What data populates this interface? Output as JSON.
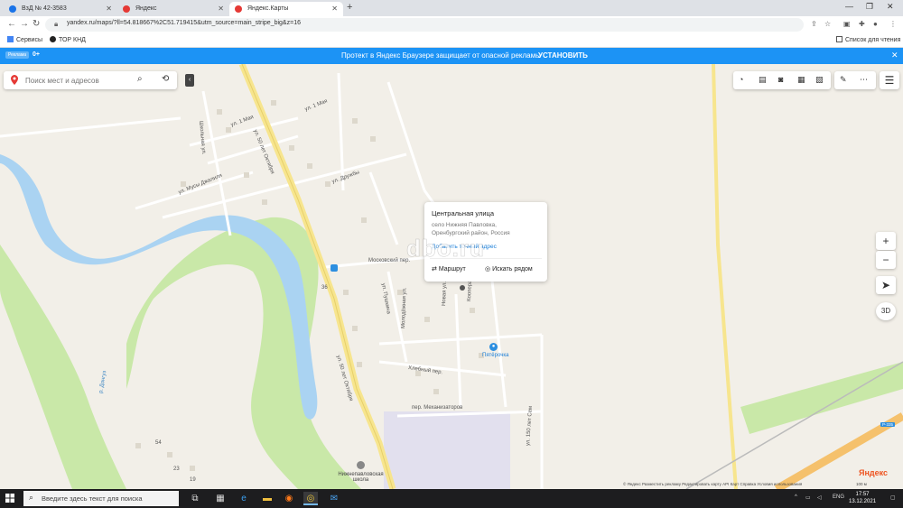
{
  "browser": {
    "tabs": [
      {
        "label": "ВзД № 42-3583",
        "color": "#1a73e8"
      },
      {
        "label": "Яндекс",
        "color": "#e53935"
      },
      {
        "label": "Яндекс.Карты",
        "color": "#e53935",
        "active": true
      }
    ],
    "url": "yandex.ru/maps/?ll=54.818667%2C51.719415&utm_source=main_stripe_big&z=16",
    "bookmarks": [
      {
        "label": "Сервисы"
      },
      {
        "label": "ТОР КНД"
      }
    ],
    "reading_list": "Список для чтения"
  },
  "banner": {
    "ad_label": "Реклама",
    "age": "0+",
    "message": "Протект в Яндекс Браузере защищает от опасной рекламы",
    "button": "УСТАНОВИТЬ",
    "accent_color": "#1c93f5"
  },
  "map": {
    "search_placeholder": "Поиск мест и адресов",
    "streets": [
      "ул. 50 лет Октября",
      "ул. 50 лет Октября",
      "ул. 1 Мая",
      "ул. 1 Мая",
      "ул. Мусы Джалиля",
      "ул. Дружбы",
      "Московский пер.",
      "ул. Пушкина",
      "Молодёжная ул.",
      "Хлебный пер.",
      "пер. Механизаторов",
      "ул. 150 лет Сем",
      "Кооперативная ул.",
      "Новая ул.",
      "р. Донгуз",
      "Школьная ул."
    ],
    "house_numbers": [
      "36",
      "54",
      "23",
      "19"
    ],
    "poi": [
      {
        "label": "Пятёрочка",
        "icon": "shopping-bag-icon"
      },
      {
        "label": "Нижнепавловская школа",
        "icon": "school-icon"
      }
    ],
    "popup": {
      "title": "Центральная улица",
      "address_line1": "село Нижняя Павловка,",
      "address_line2": "Оренбургский район, Россия",
      "link": "Добавить точный адрес",
      "watermark": "dbo.ru",
      "route_label": "Маршрут",
      "nearby_label": "Искать рядом"
    },
    "zoom_in": "+",
    "zoom_out": "−",
    "mode_3d": "3D",
    "attribution": "© Яндекс  Разместить рекламу  Редактировать карту  API Карт  Справка  Условия использования",
    "scale_label": "100 м",
    "logo": "Яндекс",
    "road_badge": "Р-335",
    "colors": {
      "river": "#aad3f2",
      "park": "#c9e8a8",
      "main_road": "#f7e58e",
      "highway": "#f5c16c"
    }
  },
  "taskbar": {
    "search_placeholder": "Введите здесь текст для поиска",
    "lang": "ENG",
    "time": "17:57",
    "date": "13.12.2021"
  }
}
